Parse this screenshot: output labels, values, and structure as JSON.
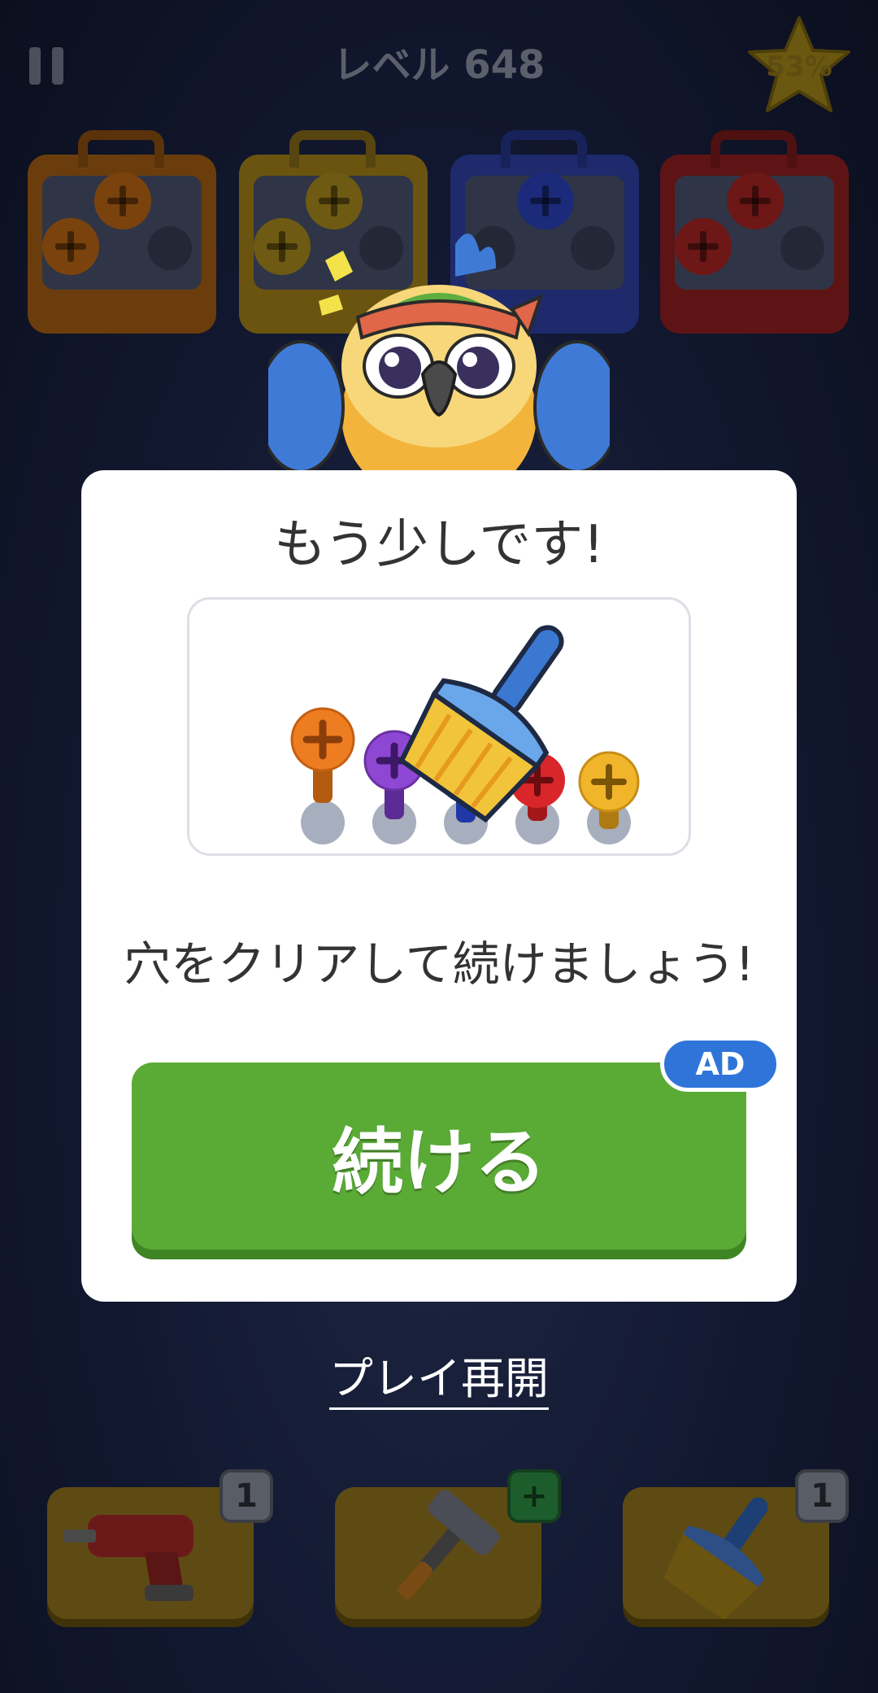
{
  "header": {
    "level_title": "レベル 648",
    "progress_percent": "53%",
    "pause_icon": "pause-icon",
    "star_icon": "star-icon"
  },
  "toolboxes": [
    {
      "color": "#6b3d0c",
      "screw_color": "#7a430d"
    },
    {
      "color": "#6a5410",
      "screw_color": "#6e5a12"
    },
    {
      "color": "#1e2a6b",
      "screw_color": "#1b2a7a"
    },
    {
      "color": "#5e1414",
      "screw_color": "#6d1717"
    }
  ],
  "modal": {
    "title": "もう少しです!",
    "message": "穴をクリアして続けましょう!",
    "continue_label": "続ける",
    "ad_badge": "AD",
    "illustration_icon": "broom-clear-holes-icon"
  },
  "resume_label": "プレイ再開",
  "tools": [
    {
      "icon": "drill-icon",
      "badge": "1"
    },
    {
      "icon": "hammer-icon",
      "badge": "+"
    },
    {
      "icon": "broom-icon",
      "badge": "1"
    }
  ],
  "colors": {
    "continue_green": "#5aaa36",
    "ad_blue": "#2f75d9"
  }
}
